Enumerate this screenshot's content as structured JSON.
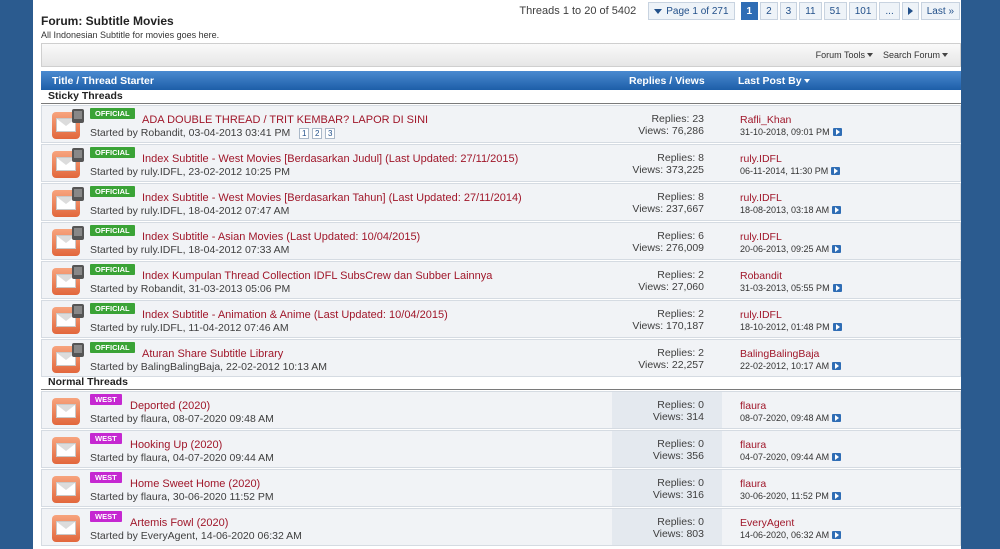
{
  "forum": {
    "title": "Forum: Subtitle Movies",
    "description": "All Indonesian Subtitle for movies goes here."
  },
  "pager": {
    "count_text": "Threads 1 to 20 of 5402",
    "page_of": "Page 1 of 271",
    "pages": [
      "1",
      "2",
      "3",
      "11",
      "51",
      "101",
      "..."
    ],
    "current": "1",
    "last": "Last"
  },
  "tools": {
    "forum_tools": "Forum Tools",
    "search_forum": "Search Forum"
  },
  "table_header": {
    "title": "Title / Thread Starter",
    "replies_views": "Replies / Views",
    "last_post": "Last Post By"
  },
  "sections": {
    "sticky": "Sticky Threads",
    "normal": "Normal Threads"
  },
  "sticky_threads": [
    {
      "badge": "OFFICIAL",
      "title": "ADA DOUBLE THREAD / TRIT KEMBAR? LAPOR DI SINI",
      "started": "Started by Robandit, 03-04-2013 03:41 PM",
      "pages": [
        "1",
        "2",
        "3"
      ],
      "replies": "Replies: 23",
      "views": "Views: 76,286",
      "last_user": "Rafli_Khan",
      "last_date": "31-10-2018, 09:01 PM"
    },
    {
      "badge": "OFFICIAL",
      "title": "Index Subtitle - West Movies [Berdasarkan Judul] (Last Updated: 27/11/2015)",
      "started": "Started by ruly.IDFL, 23-02-2012 10:25 PM",
      "replies": "Replies: 8",
      "views": "Views: 373,225",
      "last_user": "ruly.IDFL",
      "last_date": "06-11-2014, 11:30 PM"
    },
    {
      "badge": "OFFICIAL",
      "title": "Index Subtitle - West Movies [Berdasarkan Tahun] (Last Updated: 27/11/2014)",
      "started": "Started by ruly.IDFL, 18-04-2012 07:47 AM",
      "replies": "Replies: 8",
      "views": "Views: 237,667",
      "last_user": "ruly.IDFL",
      "last_date": "18-08-2013, 03:18 AM"
    },
    {
      "badge": "OFFICIAL",
      "title": "Index Subtitle - Asian Movies (Last Updated: 10/04/2015)",
      "started": "Started by ruly.IDFL, 18-04-2012 07:33 AM",
      "replies": "Replies: 6",
      "views": "Views: 276,009",
      "last_user": "ruly.IDFL",
      "last_date": "20-06-2013, 09:25 AM"
    },
    {
      "badge": "OFFICIAL",
      "title": "Index Kumpulan Thread Collection IDFL SubsCrew dan Subber Lainnya",
      "started": "Started by Robandit, 31-03-2013 05:06 PM",
      "replies": "Replies: 2",
      "views": "Views: 27,060",
      "last_user": "Robandit",
      "last_date": "31-03-2013, 05:55 PM"
    },
    {
      "badge": "OFFICIAL",
      "title": "Index Subtitle - Animation & Anime (Last Updated: 10/04/2015)",
      "started": "Started by ruly.IDFL, 11-04-2012 07:46 AM",
      "replies": "Replies: 2",
      "views": "Views: 170,187",
      "last_user": "ruly.IDFL",
      "last_date": "18-10-2012, 01:48 PM"
    },
    {
      "badge": "OFFICIAL",
      "title": "Aturan Share Subtitle Library",
      "started": "Started by BalingBalingBaja, 22-02-2012 10:13 AM",
      "replies": "Replies: 2",
      "views": "Views: 22,257",
      "last_user": "BalingBalingBaja",
      "last_date": "22-02-2012, 10:17 AM"
    }
  ],
  "normal_threads": [
    {
      "badge": "WEST",
      "title": "Deported (2020)",
      "started": "Started by flaura, 08-07-2020 09:48 AM",
      "replies": "Replies: 0",
      "views": "Views: 314",
      "last_user": "flaura",
      "last_date": "08-07-2020, 09:48 AM"
    },
    {
      "badge": "WEST",
      "title": "Hooking Up (2020)",
      "started": "Started by flaura, 04-07-2020 09:44 AM",
      "replies": "Replies: 0",
      "views": "Views: 356",
      "last_user": "flaura",
      "last_date": "04-07-2020, 09:44 AM"
    },
    {
      "badge": "WEST",
      "title": "Home Sweet Home (2020)",
      "started": "Started by flaura, 30-06-2020 11:52 PM",
      "replies": "Replies: 0",
      "views": "Views: 316",
      "last_user": "flaura",
      "last_date": "30-06-2020, 11:52 PM"
    },
    {
      "badge": "WEST",
      "title": "Artemis Fowl (2020)",
      "started": "Started by EveryAgent, 14-06-2020 06:32 AM",
      "replies": "Replies: 0",
      "views": "Views: 803",
      "last_user": "EveryAgent",
      "last_date": "14-06-2020, 06:32 AM"
    }
  ],
  "colors": {
    "background": "#2b5b8f",
    "header_blue": "#1d5ea8",
    "link_red": "#a0172a",
    "official_green": "#3aa336",
    "west_magenta": "#c528d1"
  },
  "icons": {
    "thread": "envelope-icon",
    "sticky_lock": "lock-icon",
    "go_last": "go-to-last-post-icon"
  }
}
